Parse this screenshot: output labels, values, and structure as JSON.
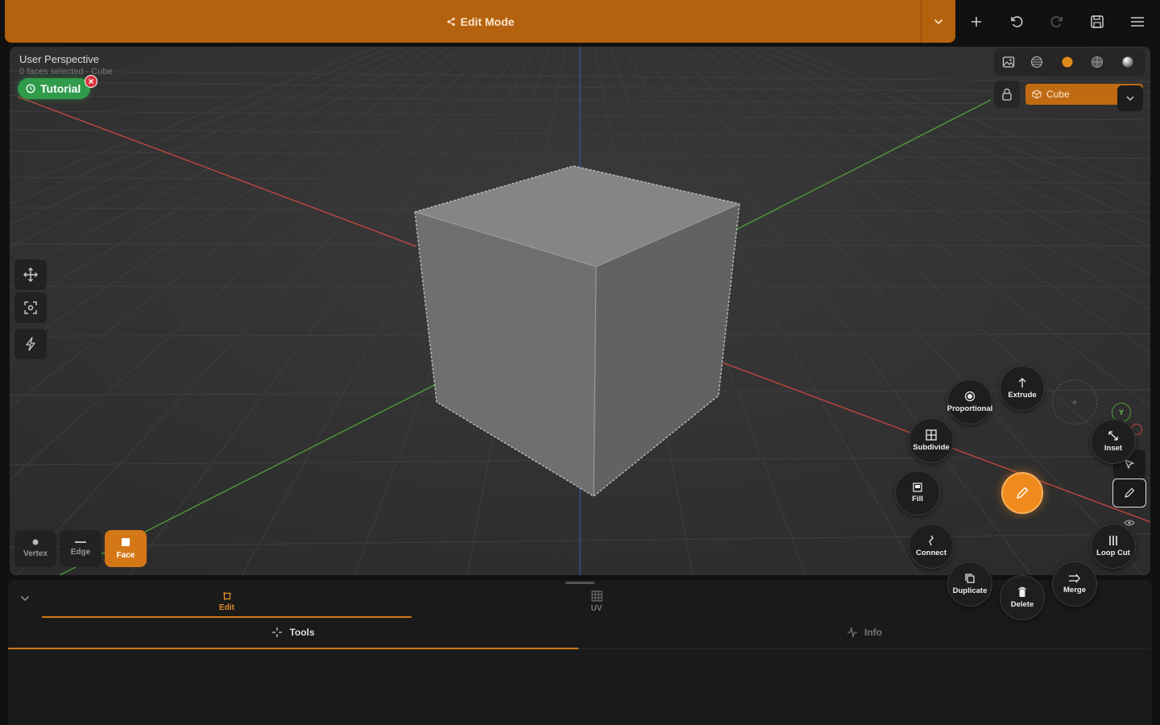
{
  "header": {
    "mode_label": "Edit Mode",
    "icons": [
      "share-icon",
      "chevron-down-icon",
      "plus-icon",
      "undo-icon",
      "redo-icon",
      "save-icon",
      "menu-icon"
    ]
  },
  "viewport": {
    "title": "User Perspective",
    "subtitle": "0 faces selected · Cube",
    "tutorial_label": "Tutorial",
    "object_name": "Cube",
    "side_tools": [
      "move-icon",
      "focus-icon",
      "quick-icon"
    ],
    "selection_modes": [
      {
        "label": "Vertex",
        "active": false
      },
      {
        "label": "Edge",
        "active": false
      },
      {
        "label": "Face",
        "active": true
      }
    ],
    "axis_labels": {
      "y": "Y"
    }
  },
  "radial_menu": {
    "items": {
      "proportional": "Proportional",
      "extrude": "Extrude",
      "subdivide": "Subdivide",
      "inset": "Inset",
      "fill": "Fill",
      "connect": "Connect",
      "loop_cut": "Loop Cut",
      "duplicate": "Duplicate",
      "delete": "Delete",
      "merge": "Merge"
    }
  },
  "panel": {
    "mode_tabs": [
      {
        "label": "Edit",
        "active": true
      },
      {
        "label": "UV",
        "active": false
      }
    ],
    "sub_tabs": [
      {
        "label": "Tools",
        "active": true
      },
      {
        "label": "Info",
        "active": false
      }
    ]
  },
  "colors": {
    "accent": "#d47717",
    "header": "#b5620e",
    "tutorial": "#2f9b4b",
    "x_axis": "#c0453f",
    "y_axis": "#4e9a3a",
    "z_axis": "#2c5f9e"
  }
}
